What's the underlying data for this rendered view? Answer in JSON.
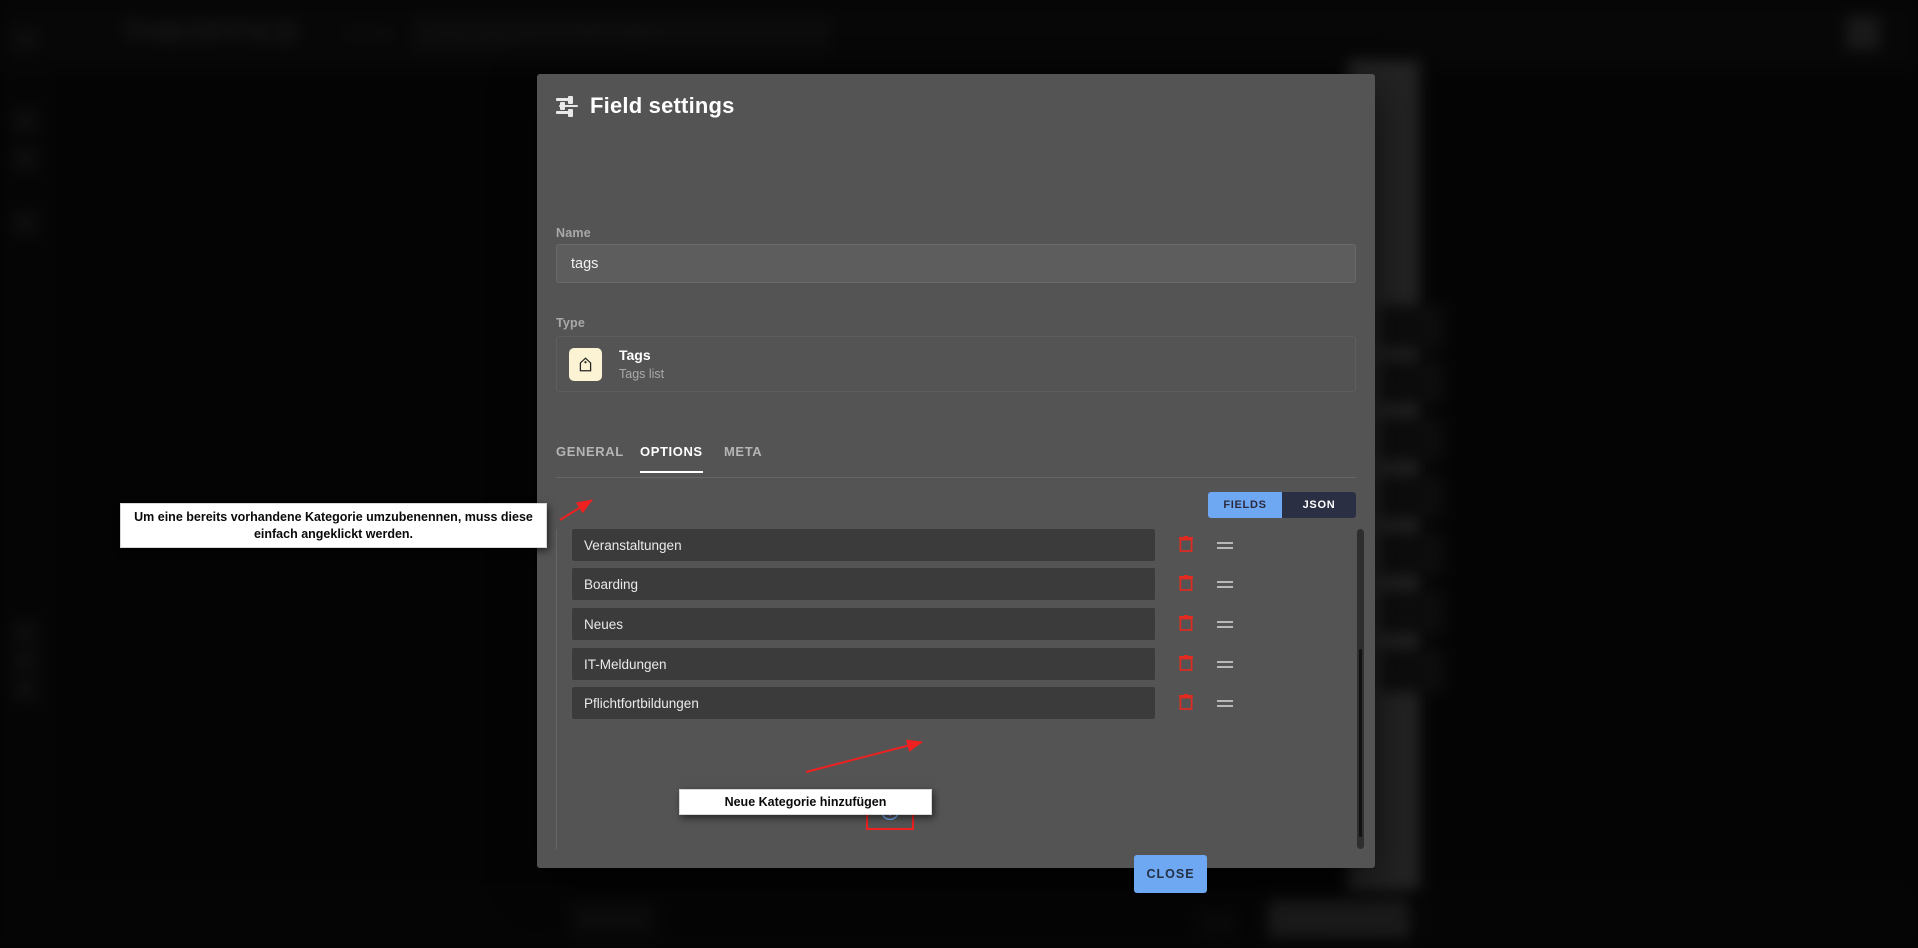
{
  "backdrop": {
    "logo": "THEOFFICE",
    "logo_sub": "Konzept",
    "search_placeholder": "Content suchen oder einen Befehl eingeben",
    "avatar": "user-avatar"
  },
  "dialog": {
    "title": "Field settings",
    "title_icon": "tune-sliders-icon",
    "name": {
      "label": "Name",
      "value": "tags",
      "placeholder": "Field name"
    },
    "type": {
      "label": "Type",
      "icon": "tag-icon",
      "name": "Tags",
      "description": "Tags list"
    },
    "tabs": [
      {
        "label": "GENERAL",
        "active": false
      },
      {
        "label": "OPTIONS",
        "active": true
      },
      {
        "label": "META",
        "active": false
      }
    ],
    "view_toggle": [
      {
        "label": "FIELDS",
        "active": true
      },
      {
        "label": "JSON",
        "active": false
      }
    ],
    "options": [
      {
        "value": "Veranstaltungen"
      },
      {
        "value": "Boarding"
      },
      {
        "value": "Neues"
      },
      {
        "value": "IT-Meldungen"
      },
      {
        "value": "Pflichtfortbildungen"
      }
    ],
    "row_icons": {
      "delete": "trash-icon",
      "drag": "drag-handle-icon"
    },
    "add_button_icon": "plus-circle-icon",
    "close_label": "CLOSE"
  },
  "annotations": [
    {
      "id": "rename",
      "text": "Um eine bereits vorhandene Kategorie umzubenennen, muss diese einfach angeklickt werden."
    },
    {
      "id": "add",
      "text": "Neue Kategorie hinzufügen"
    }
  ],
  "colors": {
    "accent_blue": "#6fa8f2",
    "toggle_dark": "#2b2f44",
    "annotation_red": "#ef2020",
    "delete_red": "#e02b20",
    "dialog_bg": "#545454",
    "row_bg": "#3b3b3b",
    "tag_icon_bg": "#fbf3d3"
  }
}
